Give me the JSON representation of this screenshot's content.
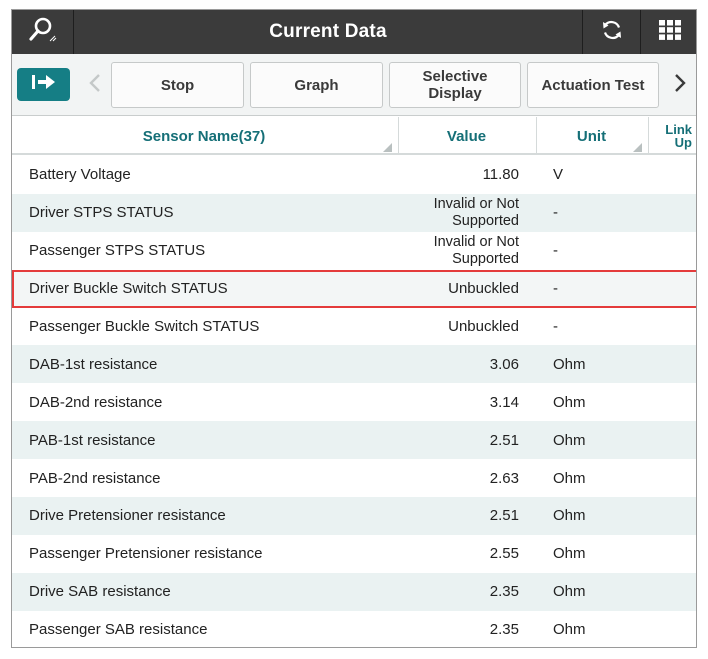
{
  "titlebar": {
    "title": "Current Data",
    "search_icon": "magnifier-icon",
    "refresh_icon": "refresh-icon",
    "grid_icon": "grid-menu-icon"
  },
  "toolbar": {
    "exit_icon": "exit-arrow-icon",
    "prev_icon": "chevron-left-icon",
    "next_icon": "chevron-right-icon",
    "stop_label": "Stop",
    "graph_label": "Graph",
    "selective_label_line1": "Selective",
    "selective_label_line2": "Display",
    "actuation_label": "Actuation Test"
  },
  "table": {
    "headers": {
      "name": "Sensor Name(37)",
      "value": "Value",
      "unit": "Unit",
      "link_line1": "Link",
      "link_line2": "Up"
    },
    "rows": [
      {
        "name": "Battery Voltage",
        "value": "11.80",
        "unit": "V"
      },
      {
        "name": "Driver STPS STATUS",
        "value_line1": "Invalid or Not",
        "value_line2": "Supported",
        "unit": "-"
      },
      {
        "name": "Passenger STPS STATUS",
        "value_line1": "Invalid or Not",
        "value_line2": "Supported",
        "unit": "-"
      },
      {
        "name": "Driver Buckle Switch STATUS",
        "value": "Unbuckled",
        "unit": "-"
      },
      {
        "name": "Passenger Buckle Switch STATUS",
        "value": "Unbuckled",
        "unit": "-"
      },
      {
        "name": "DAB-1st resistance",
        "value": "3.06",
        "unit": "Ohm"
      },
      {
        "name": "DAB-2nd resistance",
        "value": "3.14",
        "unit": "Ohm"
      },
      {
        "name": "PAB-1st resistance",
        "value": "2.51",
        "unit": "Ohm"
      },
      {
        "name": "PAB-2nd resistance",
        "value": "2.63",
        "unit": "Ohm"
      },
      {
        "name": "Drive Pretensioner resistance",
        "value": "2.51",
        "unit": "Ohm"
      },
      {
        "name": "Passenger Pretensioner resistance",
        "value": "2.55",
        "unit": "Ohm"
      },
      {
        "name": "Drive SAB resistance",
        "value": "2.35",
        "unit": "Ohm"
      },
      {
        "name": "Passenger SAB resistance",
        "value": "2.35",
        "unit": "Ohm"
      }
    ]
  },
  "colors": {
    "titlebar_bg": "#3b3b3b",
    "accent_teal": "#157e85",
    "header_text": "#156f77",
    "row_alt": "#eaf2f2",
    "highlight_border": "#e43b3b"
  }
}
